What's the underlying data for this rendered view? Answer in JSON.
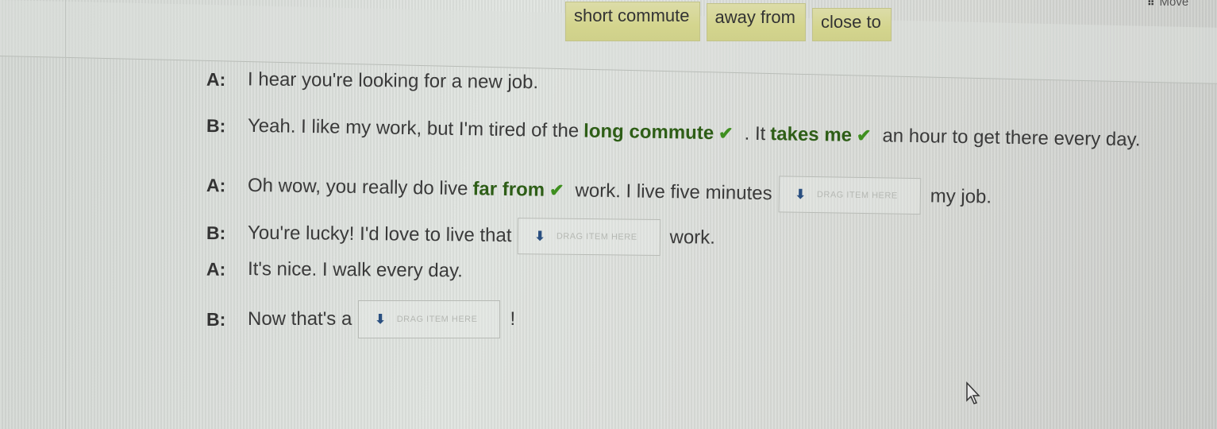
{
  "toolbar": {
    "move_label": "Move",
    "move_icon": "grip-dots-icon"
  },
  "word_bank": [
    {
      "label": "short commute"
    },
    {
      "label": "away from"
    },
    {
      "label": "close to"
    }
  ],
  "drop_zone": {
    "placeholder": "DRAG ITEM HERE",
    "icon": "down-arrow-icon"
  },
  "dialogue": [
    {
      "speaker": "A:",
      "parts": [
        "I hear you're looking for a new job."
      ]
    },
    {
      "speaker": "B:",
      "pre": "Yeah. I like my work, but I'm tired of the",
      "answer1": "long commute",
      "mid": ". It",
      "answer2": "takes me",
      "post": "an hour to get there every day."
    },
    {
      "speaker": "A:",
      "pre": "Oh wow, you really do live",
      "answer1": "far from",
      "mid": "work. I live five minutes",
      "post": "my job."
    },
    {
      "speaker": "B:",
      "pre": "You're lucky! I'd love to live that",
      "post": "work."
    },
    {
      "speaker": "A:",
      "pre": "It's nice. I walk every day."
    },
    {
      "speaker": "B:",
      "pre": "Now that's a",
      "post": "!"
    }
  ],
  "status": {
    "correct_mark": "✔",
    "correct_color": "#3e8f1f",
    "answer_color": "#2e5e17",
    "chip_color": "#d4d58e"
  }
}
